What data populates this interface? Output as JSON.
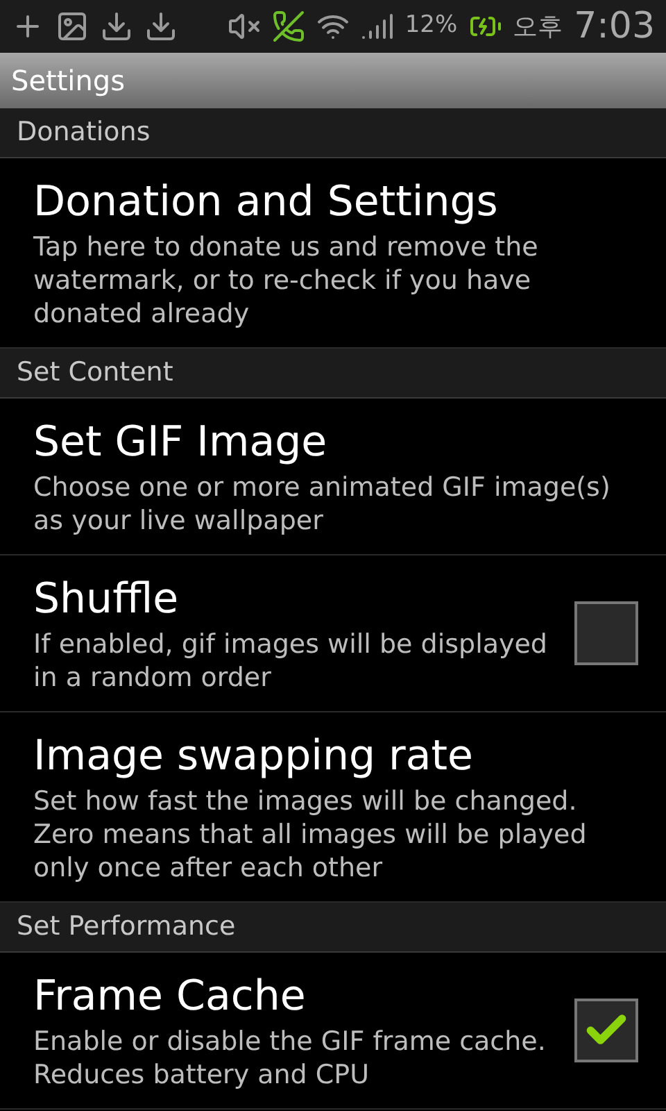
{
  "status_bar": {
    "battery": "12%",
    "ampm": "오후",
    "time": "7:03"
  },
  "title": "Settings",
  "sections": [
    {
      "header": "Donations",
      "items": [
        {
          "kind": "plain",
          "title": "Donation and Settings",
          "summary": "Tap here to donate us and remove the watermark, or to re-check if you have donated already"
        }
      ]
    },
    {
      "header": "Set Content",
      "items": [
        {
          "kind": "plain",
          "title": "Set GIF Image",
          "summary": "Choose one or more animated GIF image(s) as your live wallpaper"
        },
        {
          "kind": "checkbox",
          "title": "Shuffle",
          "summary": "If enabled, gif images will be displayed in a random order",
          "checked": false
        },
        {
          "kind": "plain",
          "title": "Image swapping rate",
          "summary": "Set how fast the images will be changed. Zero means that all images will be played only once after each other"
        }
      ]
    },
    {
      "header": "Set Performance",
      "items": [
        {
          "kind": "checkbox",
          "title": "Frame Cache",
          "summary": "Enable or disable the GIF frame cache. Reduces battery and CPU",
          "checked": true
        }
      ]
    }
  ]
}
